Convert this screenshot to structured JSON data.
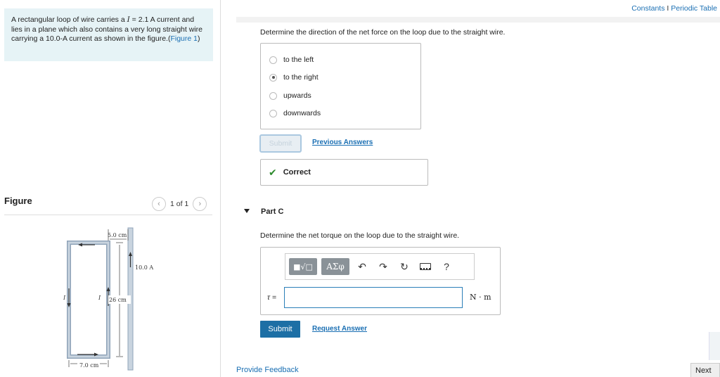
{
  "problem": {
    "intro": "A rectangular loop of wire carries a",
    "current_symbol": "I",
    "current_value": " = 2.1 A",
    "text_rest": " current and lies in a plane which also contains a very long straight wire carrying a 10.0-A current as shown in the figure.(",
    "figure_link": "Figure 1",
    "close": ")"
  },
  "figure_panel": {
    "title": "Figure",
    "counter": "1 of 1",
    "labels": {
      "top_width": "5.0 cm",
      "wire_current": "10.0 A",
      "height": "26 cm",
      "bottom_width": "7.0 cm",
      "left_current": "I",
      "right_current": "I"
    }
  },
  "header": {
    "constants": "Constants",
    "separator": "I",
    "periodic": "Periodic Table"
  },
  "part_b": {
    "question": "Determine the direction of the net force on the loop due to the straight wire.",
    "choices": [
      {
        "label": "to the left",
        "selected": false
      },
      {
        "label": "to the right",
        "selected": true
      },
      {
        "label": "upwards",
        "selected": false
      },
      {
        "label": "downwards",
        "selected": false
      }
    ],
    "submit_label": "Submit",
    "previous_answers": "Previous Answers",
    "result": "Correct"
  },
  "part_c": {
    "title": "Part C",
    "question": "Determine the net torque on the loop due to the straight wire.",
    "toolbar": {
      "template_btn": "■√□",
      "greek_btn": "ΑΣφ",
      "help": "?"
    },
    "variable": "τ =",
    "input_value": "",
    "unit": "N · m",
    "submit_label": "Submit",
    "request_answer": "Request Answer"
  },
  "footer": {
    "feedback": "Provide Feedback",
    "next": "Next"
  }
}
